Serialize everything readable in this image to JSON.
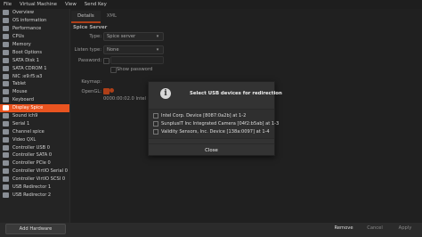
{
  "menubar": {
    "items": [
      "File",
      "Virtual Machine",
      "View",
      "Send Key"
    ]
  },
  "sidebar": {
    "items": [
      {
        "label": "Overview"
      },
      {
        "label": "OS information"
      },
      {
        "label": "Performance"
      },
      {
        "label": "CPUs"
      },
      {
        "label": "Memory"
      },
      {
        "label": "Boot Options"
      },
      {
        "label": "SATA Disk 1"
      },
      {
        "label": "SATA CDROM 1"
      },
      {
        "label": "NIC :e9:f5:a3"
      },
      {
        "label": "Tablet"
      },
      {
        "label": "Mouse"
      },
      {
        "label": "Keyboard"
      },
      {
        "label": "Display Spice"
      },
      {
        "label": "Sound ich9"
      },
      {
        "label": "Serial 1"
      },
      {
        "label": "Channel spice"
      },
      {
        "label": "Video QXL"
      },
      {
        "label": "Controller USB 0"
      },
      {
        "label": "Controller SATA 0"
      },
      {
        "label": "Controller PCIe 0"
      },
      {
        "label": "Controller VirtIO Serial 0"
      },
      {
        "label": "Controller VirtIO SCSI 0"
      },
      {
        "label": "USB Redirector 1"
      },
      {
        "label": "USB Redirector 2"
      }
    ],
    "selected_index": 12,
    "add_hardware": "Add Hardware"
  },
  "tabs": [
    "Details",
    "XML"
  ],
  "panel": {
    "section": "Spice Server",
    "type_label": "Type:",
    "type_value": "Spice server",
    "listen_label": "Listen type:",
    "listen_value": "None",
    "password_label": "Password:",
    "show_password": "Show password",
    "keymap_label": "Keymap:",
    "opengl_label": "OpenGL:",
    "render_value": "0000:00:02.0 Intel Co"
  },
  "dialog": {
    "icon": "info-icon",
    "title": "Select USB devices for redirection",
    "devices": [
      "Intel Corp. Device [8087:0a2b] at 1-2",
      "SunplusIT Inc Integrated Camera [04f2:b5ab] at 1-3",
      "Validity Sensors, Inc. Device [138a:0097] at 1-4"
    ],
    "close_label": "Close"
  },
  "footer": {
    "remove": "Remove",
    "cancel": "Cancel",
    "apply": "Apply"
  },
  "colors": {
    "accent": "#e95420",
    "background": "#2b2b2b"
  }
}
